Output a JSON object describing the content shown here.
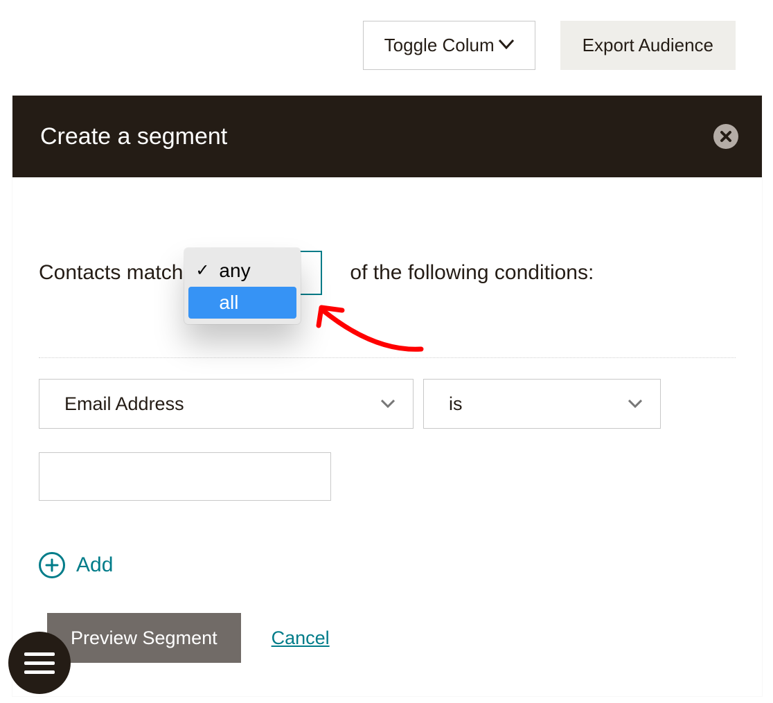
{
  "toolbar": {
    "toggle_label": "Toggle Colum",
    "export_label": "Export Audience"
  },
  "panel": {
    "title": "Create a segment"
  },
  "sentence": {
    "prefix": "Contacts match",
    "suffix": "of the following conditions:"
  },
  "match_dropdown": {
    "options": [
      {
        "label": "any",
        "checked": true,
        "highlighted": false
      },
      {
        "label": "all",
        "checked": false,
        "highlighted": true
      }
    ]
  },
  "condition": {
    "field": "Email Address",
    "operator": "is",
    "value": ""
  },
  "add_label": "Add",
  "footer": {
    "preview_label": "Preview Segment",
    "cancel_label": "Cancel"
  },
  "colors": {
    "accent": "#007c89",
    "annotation": "#ff0000"
  }
}
